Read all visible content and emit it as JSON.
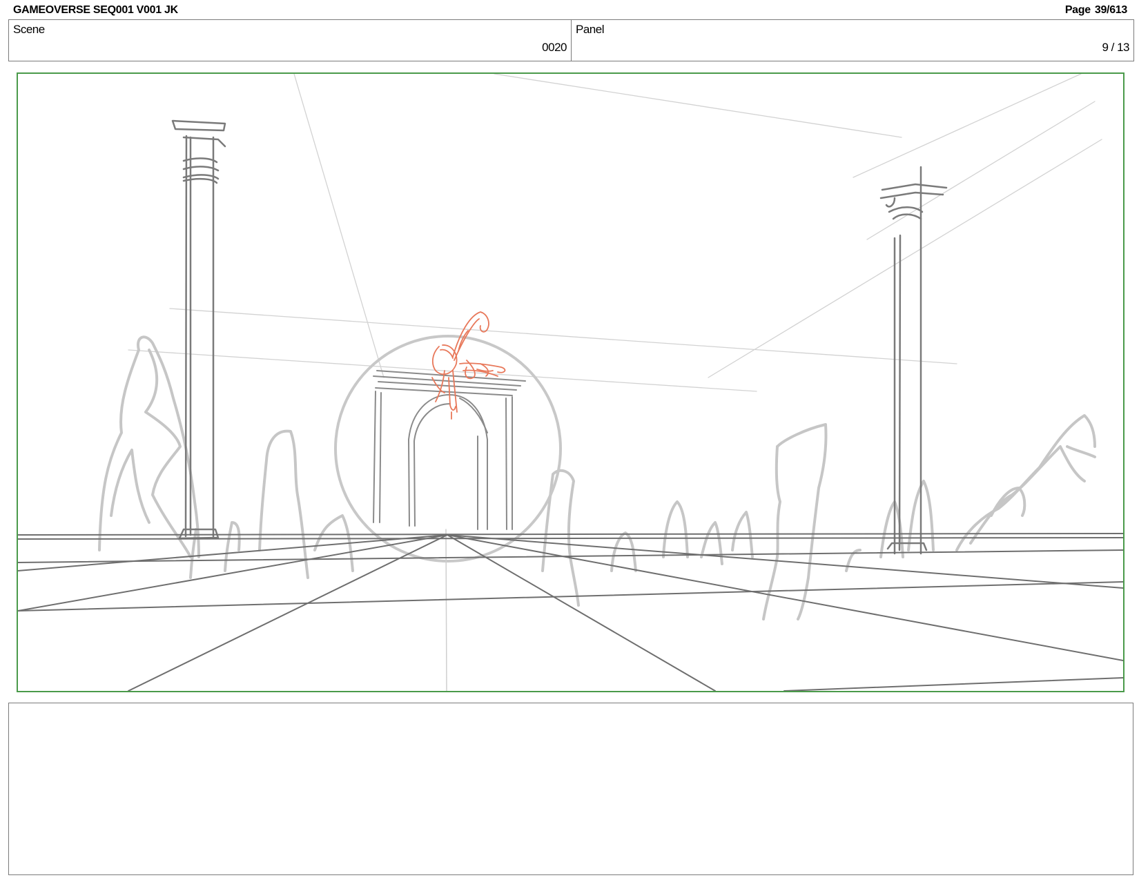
{
  "header": {
    "title": "GAMEOVERSE SEQ001 V001 JK",
    "page_label": "Page",
    "page_value": "39/613"
  },
  "scene": {
    "label": "Scene",
    "value": "0020"
  },
  "panel": {
    "label": "Panel",
    "value": "9 / 13"
  },
  "colors": {
    "frame_border": "#4a9a4a",
    "sketch_dark": "#6e6e6e",
    "sketch_light": "#c8c8c8",
    "character_sketch": "#e8785a"
  },
  "notes": {
    "text": ""
  }
}
